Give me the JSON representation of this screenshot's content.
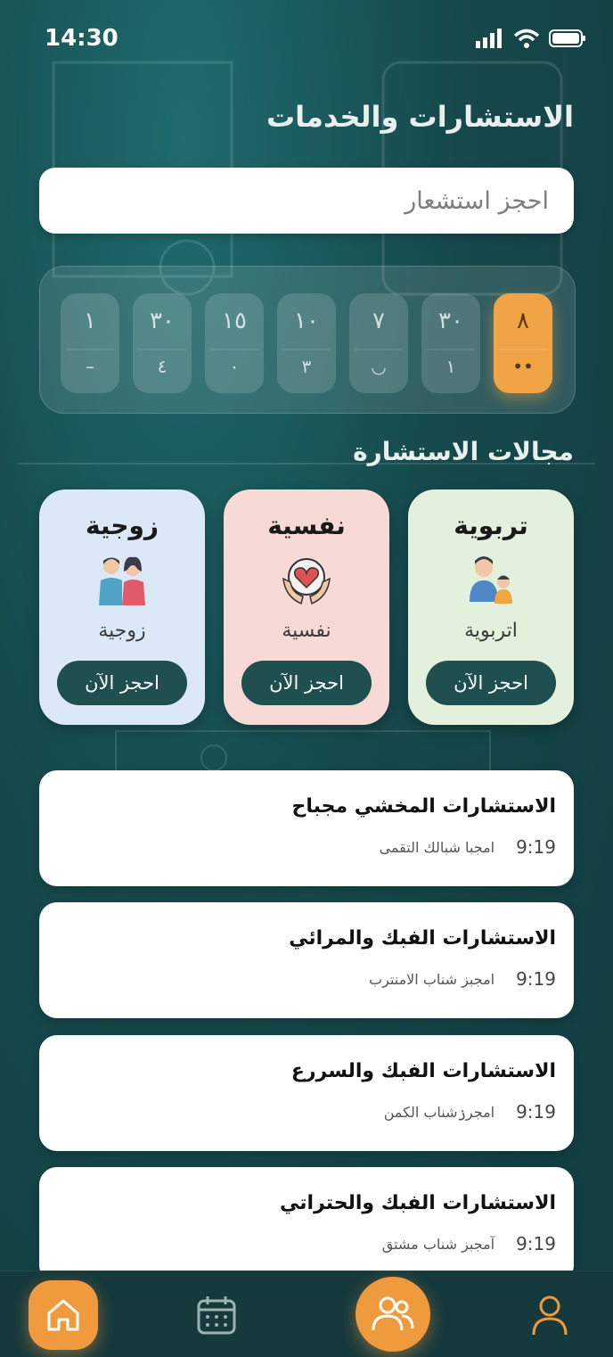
{
  "status": {
    "time": "14:30"
  },
  "header": {
    "title": "الاستشارات والخدمات"
  },
  "search": {
    "placeholder": "احجز استشعار"
  },
  "dates": [
    {
      "top": "٨",
      "bottom": "••",
      "active": true
    },
    {
      "top": "٣٠",
      "bottom": "١"
    },
    {
      "top": "٧",
      "bottom": "◡"
    },
    {
      "top": "١٠",
      "bottom": "٣"
    },
    {
      "top": "١٥",
      "bottom": "٠"
    },
    {
      "top": "٣٠",
      "bottom": "٤"
    },
    {
      "top": "١",
      "bottom": "–"
    }
  ],
  "consult_section": {
    "title": "مجالات الاستشارة"
  },
  "cards": [
    {
      "title": "تربوية",
      "subtitle": "اتربوية",
      "button": "احجز الآن",
      "bg": "#e2f0dc",
      "icon": "parent-child-icon"
    },
    {
      "title": "نفسية",
      "subtitle": "نفسية",
      "button": "احجز الآن",
      "bg": "#f7d9d6",
      "icon": "heart-hands-icon"
    },
    {
      "title": "زوجية",
      "subtitle": "زوجية",
      "button": "احجز الآن",
      "bg": "#dbe8f7",
      "icon": "couple-icon"
    }
  ],
  "list": [
    {
      "title": "الاستشارات المخشي مجباح",
      "time": "9:19",
      "subtitle": "امجبا شبالك التقمى"
    },
    {
      "title": "الاستشارات الفبك والمرائي",
      "time": "9:19",
      "subtitle": "امجبز شناب الامنترب"
    },
    {
      "title": "الاستشارات الفبك والسررع",
      "time": "9:19",
      "subtitle": "امجرۯشناب الكمن"
    },
    {
      "title": "الاستشارات الفبك والحتراتي",
      "time": "9:19",
      "subtitle": "آمجبز شناب مشتق"
    }
  ],
  "nav": {
    "items": [
      "home-icon",
      "calendar-icon",
      "people-icon",
      "profile-icon"
    ],
    "accent": "#f09a3e"
  }
}
